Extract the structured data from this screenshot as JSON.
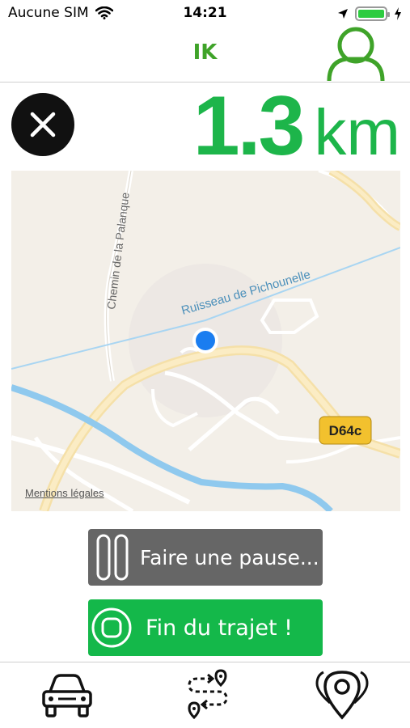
{
  "status": {
    "carrier": "Aucune SIM",
    "time": "14:21",
    "battery_level": 1.0,
    "battery_color": "#2ecc40"
  },
  "header": {
    "title": "IK",
    "title_color": "#3fa329",
    "profile_icon": "user-icon"
  },
  "trip": {
    "distance_value": "1.3",
    "distance_unit": "km",
    "distance_color": "#1db54a",
    "close_icon": "close-icon"
  },
  "map": {
    "labels": {
      "road_1": "Chemin de la Palanque",
      "stream": "Ruisseau de Pichounelle",
      "road_badge": "D64c"
    },
    "legal_link": "Mentions légales",
    "location_marker_color": "#1a7df0"
  },
  "actions": {
    "pause_label": "Faire une pause...",
    "pause_icon": "pause-icon",
    "pause_color": "#666666",
    "stop_label": "Fin du trajet !",
    "stop_icon": "stop-icon",
    "stop_color": "#14b84a"
  },
  "tabs": [
    {
      "name": "trip",
      "icon": "car-icon"
    },
    {
      "name": "route",
      "icon": "route-icon"
    },
    {
      "name": "places",
      "icon": "map-pins-icon"
    }
  ]
}
